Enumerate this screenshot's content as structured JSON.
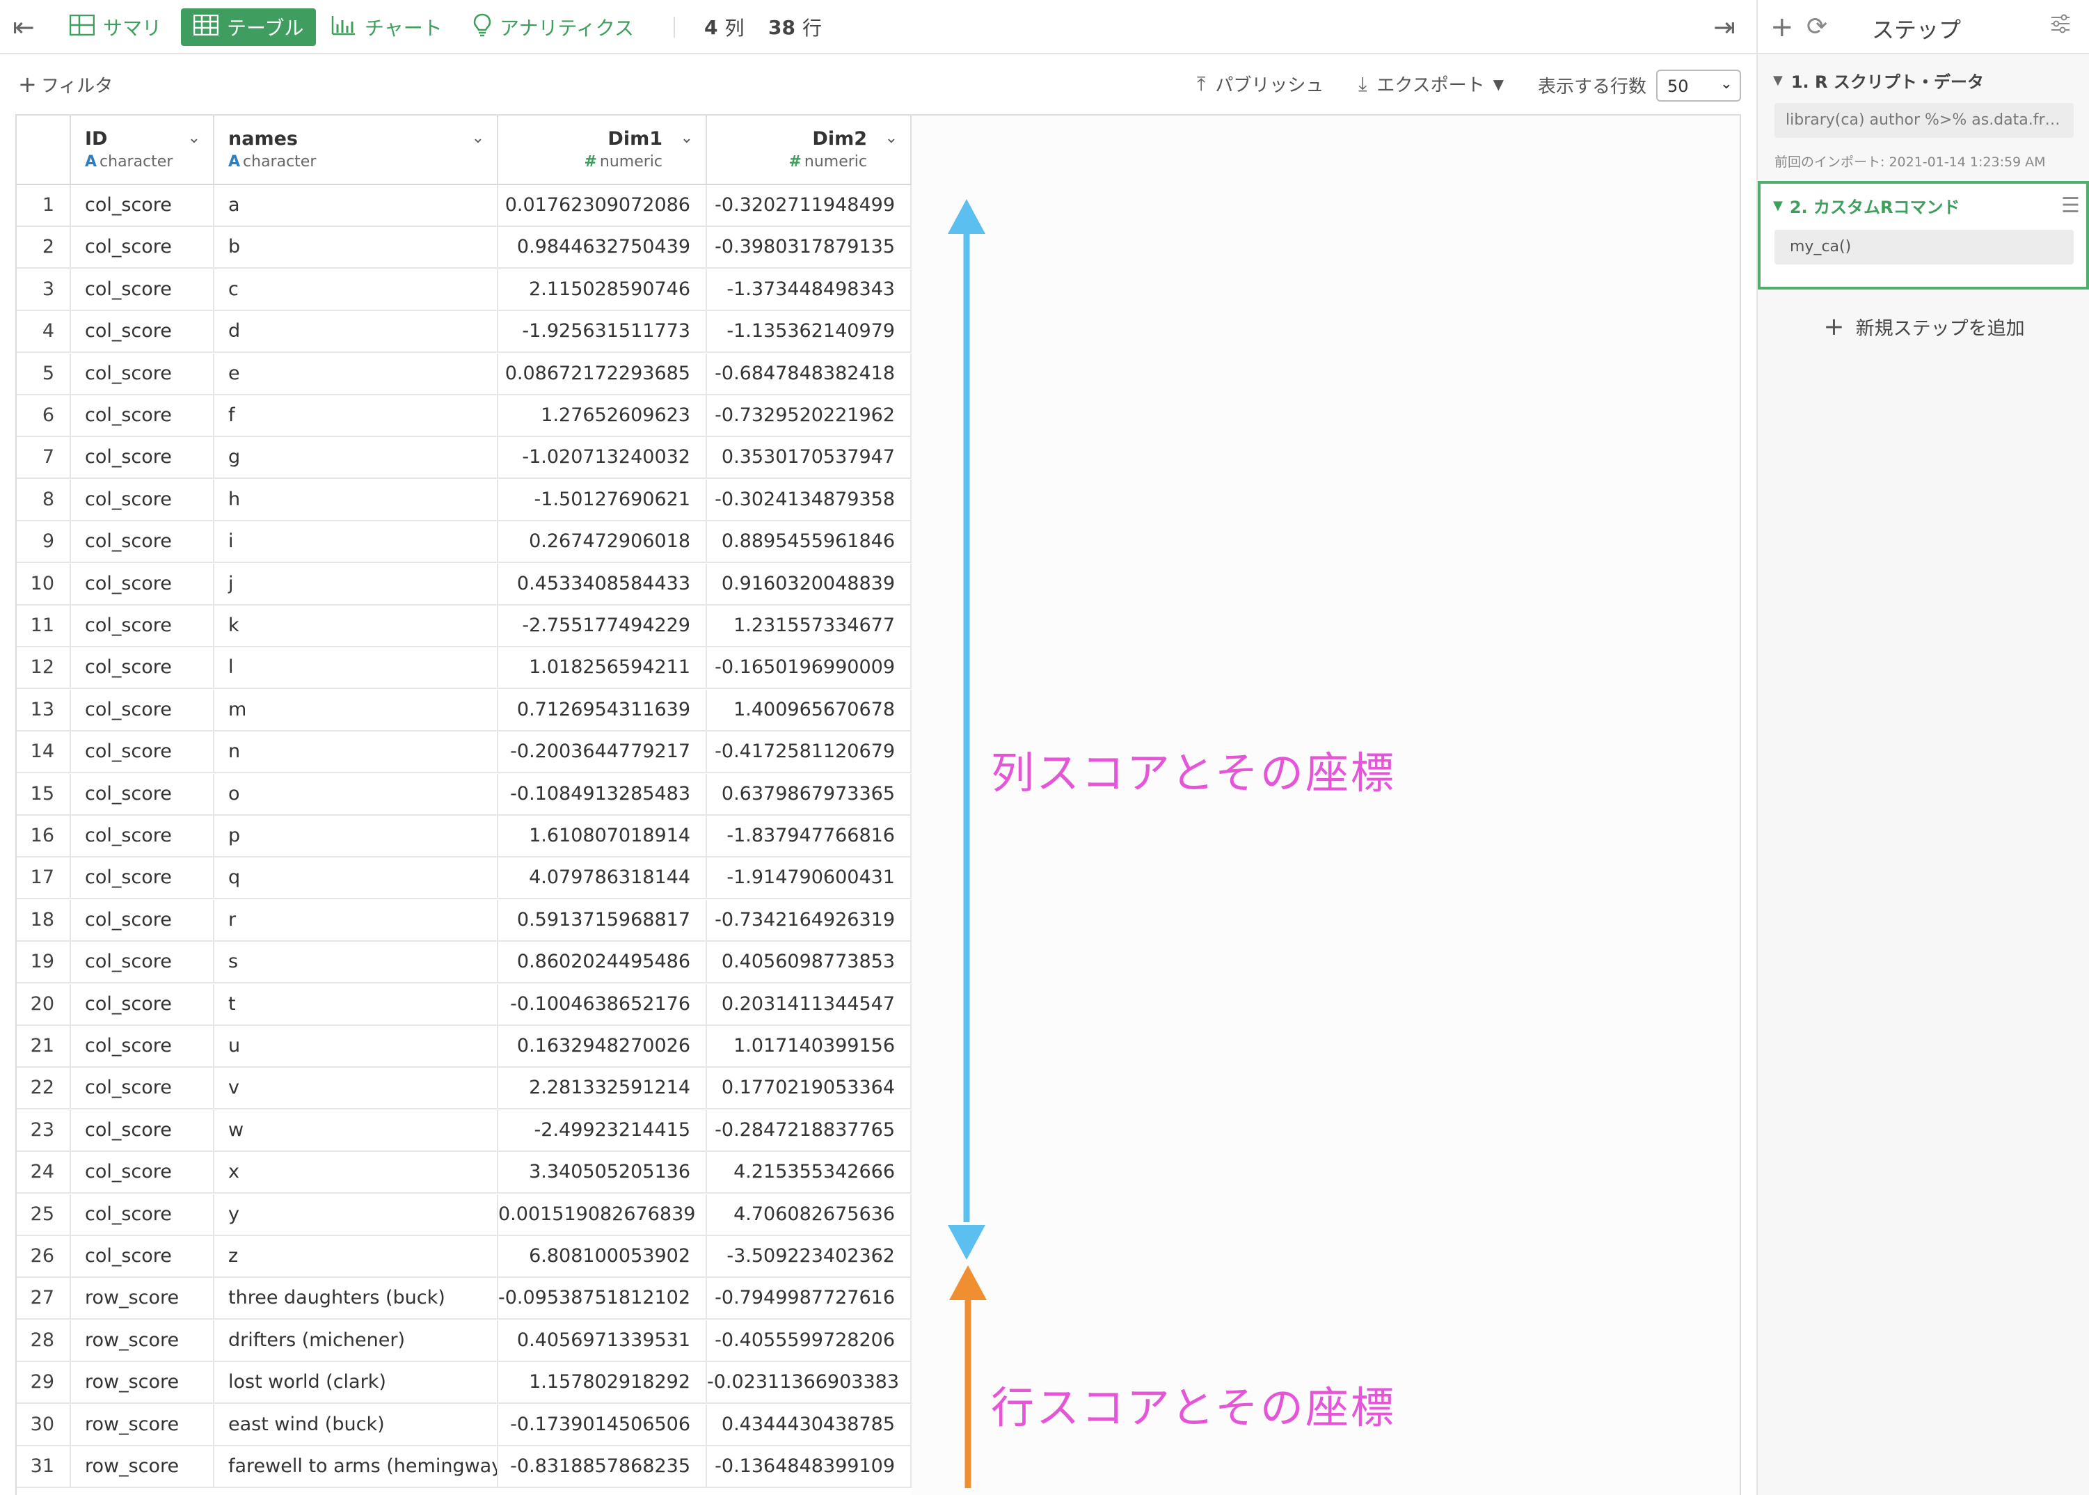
{
  "toolbar": {
    "tabs": [
      {
        "label": "サマリ",
        "icon": "summary-grid-icon"
      },
      {
        "label": "テーブル",
        "icon": "table-icon"
      },
      {
        "label": "チャート",
        "icon": "chart-icon"
      },
      {
        "label": "アナリティクス",
        "icon": "lightbulb-icon"
      }
    ],
    "cols_count": "4",
    "cols_unit": "列",
    "rows_count": "38",
    "rows_unit": "行"
  },
  "subbar": {
    "filter_label": "フィルタ",
    "publish_label": "パブリッシュ",
    "export_label": "エクスポート",
    "rows_shown_label": "表示する行数",
    "rows_shown_value": "50"
  },
  "steps_panel": {
    "title": "ステップ",
    "steps": [
      {
        "label": "1. R スクリプト・データ",
        "code": "library(ca) author %>% as.data.fra...",
        "note": "前回のインポート: 2021-01-14 1:23:59 AM"
      },
      {
        "label": "2. カスタムRコマンド",
        "code": "my_ca()"
      }
    ],
    "add_step_label": "新規ステップを追加"
  },
  "table": {
    "columns": [
      {
        "name": "ID",
        "type": "character",
        "type_mark": "A"
      },
      {
        "name": "names",
        "type": "character",
        "type_mark": "A"
      },
      {
        "name": "Dim1",
        "type": "numeric",
        "type_mark": "#"
      },
      {
        "name": "Dim2",
        "type": "numeric",
        "type_mark": "#"
      }
    ],
    "rows": [
      [
        "1",
        "col_score",
        "a",
        "0.01762309072086",
        "-0.3202711948499"
      ],
      [
        "2",
        "col_score",
        "b",
        "0.9844632750439",
        "-0.3980317879135"
      ],
      [
        "3",
        "col_score",
        "c",
        "2.115028590746",
        "-1.373448498343"
      ],
      [
        "4",
        "col_score",
        "d",
        "-1.925631511773",
        "-1.135362140979"
      ],
      [
        "5",
        "col_score",
        "e",
        "0.08672172293685",
        "-0.6847848382418"
      ],
      [
        "6",
        "col_score",
        "f",
        "1.27652609623",
        "-0.7329520221962"
      ],
      [
        "7",
        "col_score",
        "g",
        "-1.020713240032",
        "0.3530170537947"
      ],
      [
        "8",
        "col_score",
        "h",
        "-1.50127690621",
        "-0.3024134879358"
      ],
      [
        "9",
        "col_score",
        "i",
        "0.267472906018",
        "0.8895455961846"
      ],
      [
        "10",
        "col_score",
        "j",
        "0.4533408584433",
        "0.9160320048839"
      ],
      [
        "11",
        "col_score",
        "k",
        "-2.755177494229",
        "1.231557334677"
      ],
      [
        "12",
        "col_score",
        "l",
        "1.018256594211",
        "-0.1650196990009"
      ],
      [
        "13",
        "col_score",
        "m",
        "0.7126954311639",
        "1.400965670678"
      ],
      [
        "14",
        "col_score",
        "n",
        "-0.2003644779217",
        "-0.4172581120679"
      ],
      [
        "15",
        "col_score",
        "o",
        "-0.1084913285483",
        "0.6379867973365"
      ],
      [
        "16",
        "col_score",
        "p",
        "1.610807018914",
        "-1.837947766816"
      ],
      [
        "17",
        "col_score",
        "q",
        "4.079786318144",
        "-1.914790600431"
      ],
      [
        "18",
        "col_score",
        "r",
        "0.5913715968817",
        "-0.7342164926319"
      ],
      [
        "19",
        "col_score",
        "s",
        "0.8602024495486",
        "0.4056098773853"
      ],
      [
        "20",
        "col_score",
        "t",
        "-0.1004638652176",
        "0.2031411344547"
      ],
      [
        "21",
        "col_score",
        "u",
        "0.1632948270026",
        "1.017140399156"
      ],
      [
        "22",
        "col_score",
        "v",
        "2.281332591214",
        "0.1770219053364"
      ],
      [
        "23",
        "col_score",
        "w",
        "-2.49923214415",
        "-0.2847218837765"
      ],
      [
        "24",
        "col_score",
        "x",
        "3.340505205136",
        "4.215355342666"
      ],
      [
        "25",
        "col_score",
        "y",
        "0.001519082676839",
        "4.706082675636"
      ],
      [
        "26",
        "col_score",
        "z",
        "6.808100053902",
        "-3.509223402362"
      ],
      [
        "27",
        "row_score",
        "three daughters (buck)",
        "-0.09538751812102",
        "-0.7949987727616"
      ],
      [
        "28",
        "row_score",
        "drifters (michener)",
        "0.4056971339531",
        "-0.4055599728206"
      ],
      [
        "29",
        "row_score",
        "lost world (clark)",
        "1.157802918292",
        "-0.02311366903383"
      ],
      [
        "30",
        "row_score",
        "east wind (buck)",
        "-0.1739014506506",
        "0.4344430438785"
      ],
      [
        "31",
        "row_score",
        "farewell to arms (hemingway)",
        "-0.8318857868235",
        "-0.1364848399109"
      ]
    ]
  },
  "annotations": {
    "col_scores_label": "列スコアとその座標",
    "row_scores_label": "行スコアとその座標",
    "col_arrow_color": "#5bc0f0",
    "row_arrow_color": "#ef8f31",
    "label_color": "#e455d8"
  },
  "colors": {
    "accent_green": "#3f9e5f",
    "type_char_blue": "#2d7fc1"
  }
}
